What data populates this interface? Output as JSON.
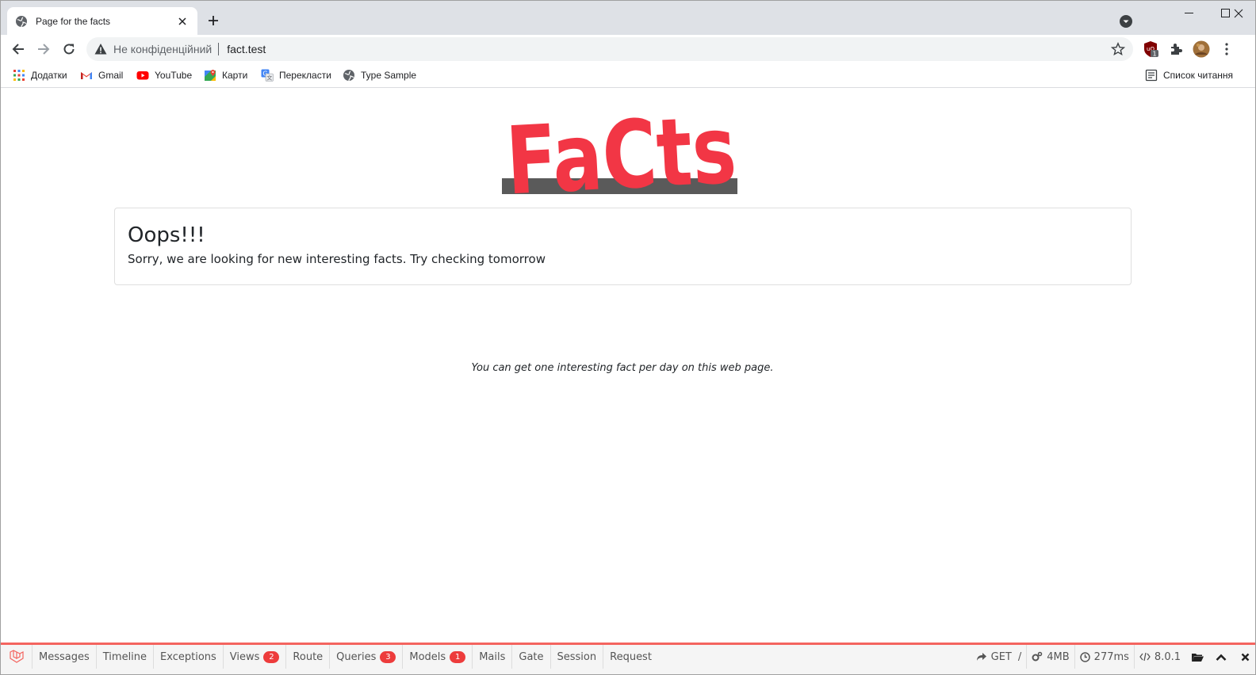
{
  "browser": {
    "tab": {
      "title": "Page for the facts"
    },
    "address": {
      "security_label": "Не конфіденційний",
      "url": "fact.test"
    },
    "bookmarks": [
      {
        "label": "Додатки",
        "icon": "apps-grid-icon"
      },
      {
        "label": "Gmail",
        "icon": "gmail-icon"
      },
      {
        "label": "YouTube",
        "icon": "youtube-icon"
      },
      {
        "label": "Карти",
        "icon": "maps-icon"
      },
      {
        "label": "Перекласти",
        "icon": "translate-icon"
      },
      {
        "label": "Type Sample",
        "icon": "globe-icon"
      }
    ],
    "reading_list": "Список читання",
    "extension_badge": "1"
  },
  "page": {
    "logo_text": "FaCts",
    "card": {
      "title": "Oops!!!",
      "message": "Sorry, we are looking for new interesting facts. Try checking tomorrow"
    },
    "footnote": "You can get one interesting fact per day on this web page."
  },
  "debugbar": {
    "tabs": [
      {
        "label": "Messages"
      },
      {
        "label": "Timeline"
      },
      {
        "label": "Exceptions"
      },
      {
        "label": "Views",
        "badge": "2"
      },
      {
        "label": "Route"
      },
      {
        "label": "Queries",
        "badge": "3"
      },
      {
        "label": "Models",
        "badge": "1"
      },
      {
        "label": "Mails"
      },
      {
        "label": "Gate"
      },
      {
        "label": "Session"
      },
      {
        "label": "Request"
      }
    ],
    "method": "GET",
    "route": "/",
    "memory": "4MB",
    "time": "277ms",
    "version": "8.0.1"
  },
  "colors": {
    "logo_red": "#f23645",
    "logo_shadow": "#5a5a5a",
    "debug_accent": "#f4645f",
    "badge_red": "#ed3c3c"
  }
}
